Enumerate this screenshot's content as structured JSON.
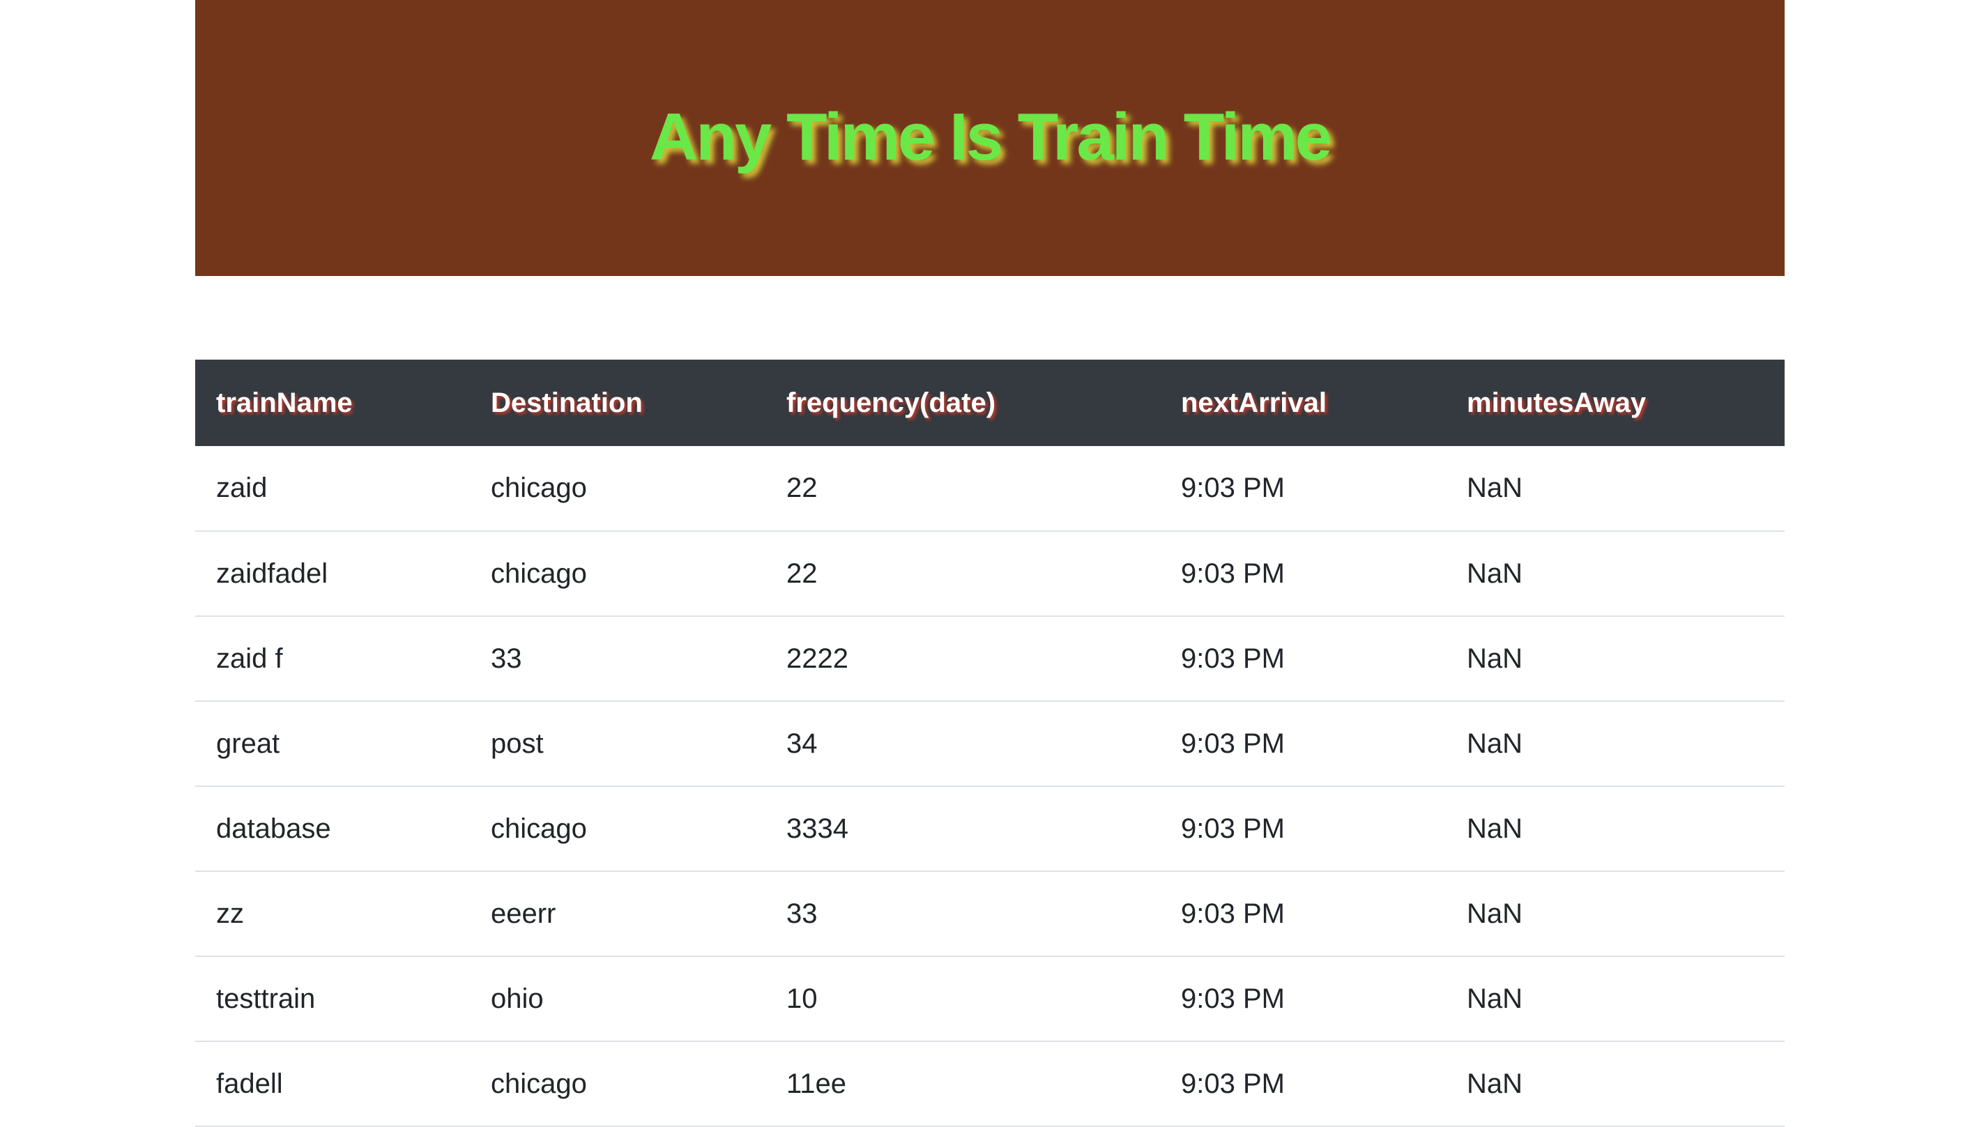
{
  "header": {
    "title": "Any Time Is Train Time"
  },
  "table": {
    "columns": [
      "trainName",
      "Destination",
      "frequency(date)",
      "nextArrival",
      "minutesAway"
    ],
    "rows": [
      [
        "zaid",
        "chicago",
        "22",
        "9:03 PM",
        "NaN"
      ],
      [
        "zaidfadel",
        "chicago",
        "22",
        "9:03 PM",
        "NaN"
      ],
      [
        "zaid f",
        "33",
        "2222",
        "9:03 PM",
        "NaN"
      ],
      [
        "great",
        "post",
        "34",
        "9:03 PM",
        "NaN"
      ],
      [
        "database",
        "chicago",
        "3334",
        "9:03 PM",
        "NaN"
      ],
      [
        "zz",
        "eeerr",
        "33",
        "9:03 PM",
        "NaN"
      ],
      [
        "testtrain",
        "ohio",
        "10",
        "9:03 PM",
        "NaN"
      ],
      [
        "fadell",
        "chicago",
        "11ee",
        "9:03 PM",
        "NaN"
      ]
    ]
  },
  "colors": {
    "header_bg": "#74361b",
    "title_color": "#6ae848",
    "table_head_bg": "#343a40",
    "row_border": "#dee2e6"
  }
}
